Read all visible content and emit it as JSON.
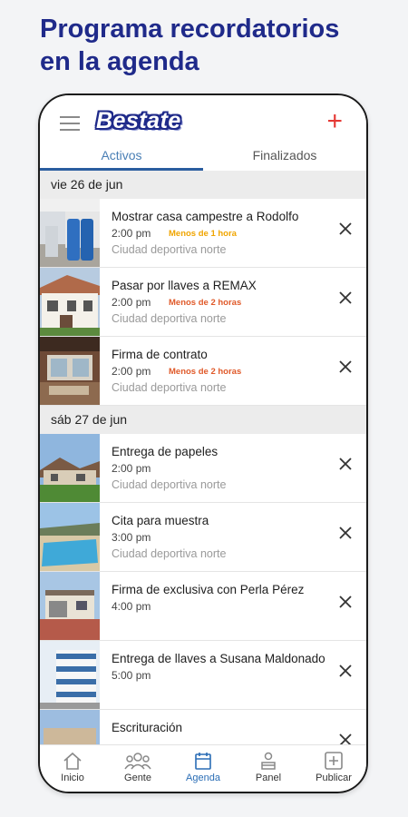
{
  "headline": {
    "line1": "Programa recordatorios",
    "line2": "en la agenda"
  },
  "app": {
    "logo_text": "Bestate",
    "colors": {
      "brand": "#1f2a8a",
      "accent_red": "#e53935",
      "tab_active": "#2a5d9f"
    }
  },
  "tabs": [
    {
      "label": "Activos",
      "active": true
    },
    {
      "label": "Finalizados",
      "active": false
    }
  ],
  "sections": [
    {
      "date": "vie 26 de jun"
    },
    {
      "date": "sáb 27 de jun"
    }
  ],
  "events": [
    {
      "title": "Mostrar casa campestre a Rodolfo",
      "time": "2:00 pm",
      "badge": "Menos de 1 hora",
      "badge_color": "#f0a500",
      "location": "Ciudad deportiva norte",
      "thumb_icon": "house-photo"
    },
    {
      "title": "Pasar por llaves a REMAX",
      "time": "2:00 pm",
      "badge": "Menos de 2 horas",
      "badge_color": "#e05a2a",
      "location": "Ciudad deportiva norte",
      "thumb_icon": "house-photo"
    },
    {
      "title": "Firma de contrato",
      "time": "2:00 pm",
      "badge": "Menos de 2 horas",
      "badge_color": "#e05a2a",
      "location": "Ciudad deportiva norte",
      "thumb_icon": "house-photo"
    },
    {
      "title": "Entrega de papeles",
      "time": "2:00 pm",
      "badge": "",
      "location": "Ciudad deportiva norte",
      "thumb_icon": "house-photo"
    },
    {
      "title": "Cita para muestra",
      "time": "3:00 pm",
      "badge": "",
      "location": "Ciudad deportiva norte",
      "thumb_icon": "house-photo"
    },
    {
      "title": "Firma de exclusiva con Perla Pérez",
      "time": "4:00 pm",
      "badge": "",
      "location": "",
      "thumb_icon": "house-photo"
    },
    {
      "title": "Entrega de llaves a Susana Maldonado",
      "time": "5:00 pm",
      "badge": "",
      "location": "",
      "thumb_icon": "house-photo"
    },
    {
      "title": "Escrituración",
      "time": "",
      "badge": "",
      "location": "",
      "thumb_icon": "house-photo"
    }
  ],
  "nav": [
    {
      "label": "Inicio",
      "icon": "home-icon",
      "active": false
    },
    {
      "label": "Gente",
      "icon": "people-icon",
      "active": false
    },
    {
      "label": "Agenda",
      "icon": "calendar-icon",
      "active": true
    },
    {
      "label": "Panel",
      "icon": "dashboard-icon",
      "active": false
    },
    {
      "label": "Publicar",
      "icon": "add-box-icon",
      "active": false
    }
  ]
}
